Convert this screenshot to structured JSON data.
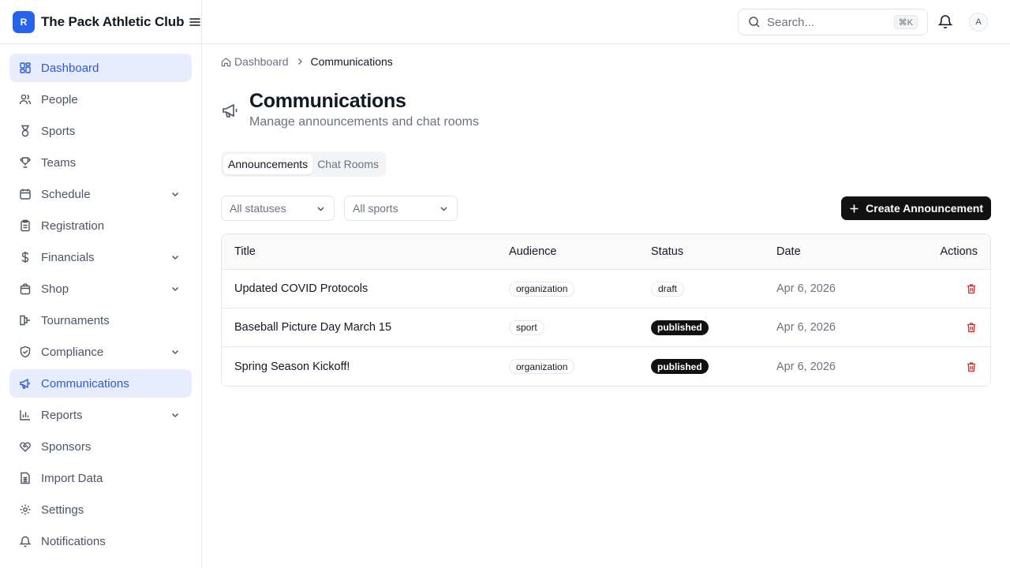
{
  "app": {
    "logo_letter": "R",
    "name": "The Pack Athletic Club"
  },
  "colors": {
    "brand": "#2563eb",
    "active_bg": "#e8edfd",
    "active_text": "#2b59d9",
    "danger": "#dc2626",
    "primary_button": "#111111"
  },
  "sidebar": {
    "items": [
      {
        "label": "Dashboard",
        "icon": "dashboard-icon",
        "active": true,
        "expandable": false
      },
      {
        "label": "People",
        "icon": "users-icon",
        "active": false,
        "expandable": false
      },
      {
        "label": "Sports",
        "icon": "medal-icon",
        "active": false,
        "expandable": false
      },
      {
        "label": "Teams",
        "icon": "trophy-icon",
        "active": false,
        "expandable": false
      },
      {
        "label": "Schedule",
        "icon": "calendar-icon",
        "active": false,
        "expandable": true
      },
      {
        "label": "Registration",
        "icon": "clipboard-icon",
        "active": false,
        "expandable": false
      },
      {
        "label": "Financials",
        "icon": "dollar-icon",
        "active": false,
        "expandable": true
      },
      {
        "label": "Shop",
        "icon": "shopping-bag-icon",
        "active": false,
        "expandable": true
      },
      {
        "label": "Tournaments",
        "icon": "bracket-icon",
        "active": false,
        "expandable": false
      },
      {
        "label": "Compliance",
        "icon": "shield-check-icon",
        "active": false,
        "expandable": true
      },
      {
        "label": "Communications",
        "icon": "megaphone-icon",
        "active": true,
        "expandable": false
      },
      {
        "label": "Reports",
        "icon": "bar-chart-icon",
        "active": false,
        "expandable": true
      },
      {
        "label": "Sponsors",
        "icon": "handshake-icon",
        "active": false,
        "expandable": false
      },
      {
        "label": "Import Data",
        "icon": "file-spreadsheet-icon",
        "active": false,
        "expandable": false
      },
      {
        "label": "Settings",
        "icon": "gear-icon",
        "active": false,
        "expandable": false
      },
      {
        "label": "Notifications",
        "icon": "bell-icon",
        "active": false,
        "expandable": false
      }
    ]
  },
  "topbar": {
    "search_placeholder": "Search...",
    "shortcut": "⌘K",
    "avatar_initial": "A"
  },
  "breadcrumb": {
    "home": "Dashboard",
    "current": "Communications"
  },
  "page": {
    "title": "Communications",
    "subtitle": "Manage announcements and chat rooms"
  },
  "tabs": [
    {
      "label": "Announcements",
      "active": true
    },
    {
      "label": "Chat Rooms",
      "active": false
    }
  ],
  "filters": {
    "status": "All statuses",
    "sport": "All sports"
  },
  "create_button": "Create Announcement",
  "table": {
    "headers": [
      "Title",
      "Audience",
      "Status",
      "Date",
      "Actions"
    ],
    "rows": [
      {
        "title": "Updated COVID Protocols",
        "audience": "organization",
        "status": "draft",
        "date": "Apr 6, 2026"
      },
      {
        "title": "Baseball Picture Day March 15",
        "audience": "sport",
        "status": "published",
        "date": "Apr 6, 2026"
      },
      {
        "title": "Spring Season Kickoff!",
        "audience": "organization",
        "status": "published",
        "date": "Apr 6, 2026"
      }
    ]
  }
}
